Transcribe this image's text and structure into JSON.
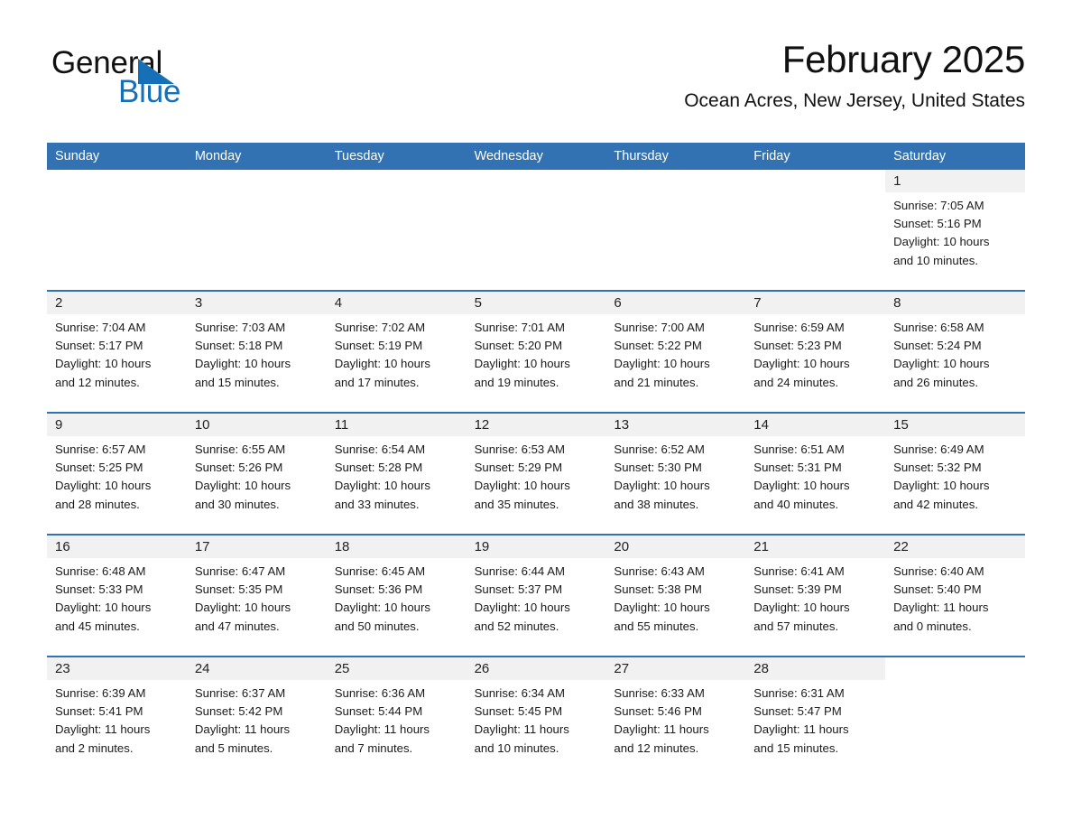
{
  "logo": {
    "word_black": "General",
    "word_blue": "Blue",
    "triangle_color": "#1570b8"
  },
  "header": {
    "title": "February 2025",
    "location": "Ocean Acres, New Jersey, United States"
  },
  "colors": {
    "header_blue": "#3272b2",
    "daynum_band": "#f1f1f1",
    "text": "#1a1a1a"
  },
  "weekdays": [
    "Sunday",
    "Monday",
    "Tuesday",
    "Wednesday",
    "Thursday",
    "Friday",
    "Saturday"
  ],
  "weeks": [
    [
      {
        "day": "",
        "empty": true
      },
      {
        "day": "",
        "empty": true
      },
      {
        "day": "",
        "empty": true
      },
      {
        "day": "",
        "empty": true
      },
      {
        "day": "",
        "empty": true
      },
      {
        "day": "",
        "empty": true
      },
      {
        "day": "1",
        "sunrise": "Sunrise: 7:05 AM",
        "sunset": "Sunset: 5:16 PM",
        "daylight1": "Daylight: 10 hours",
        "daylight2": "and 10 minutes."
      }
    ],
    [
      {
        "day": "2",
        "sunrise": "Sunrise: 7:04 AM",
        "sunset": "Sunset: 5:17 PM",
        "daylight1": "Daylight: 10 hours",
        "daylight2": "and 12 minutes."
      },
      {
        "day": "3",
        "sunrise": "Sunrise: 7:03 AM",
        "sunset": "Sunset: 5:18 PM",
        "daylight1": "Daylight: 10 hours",
        "daylight2": "and 15 minutes."
      },
      {
        "day": "4",
        "sunrise": "Sunrise: 7:02 AM",
        "sunset": "Sunset: 5:19 PM",
        "daylight1": "Daylight: 10 hours",
        "daylight2": "and 17 minutes."
      },
      {
        "day": "5",
        "sunrise": "Sunrise: 7:01 AM",
        "sunset": "Sunset: 5:20 PM",
        "daylight1": "Daylight: 10 hours",
        "daylight2": "and 19 minutes."
      },
      {
        "day": "6",
        "sunrise": "Sunrise: 7:00 AM",
        "sunset": "Sunset: 5:22 PM",
        "daylight1": "Daylight: 10 hours",
        "daylight2": "and 21 minutes."
      },
      {
        "day": "7",
        "sunrise": "Sunrise: 6:59 AM",
        "sunset": "Sunset: 5:23 PM",
        "daylight1": "Daylight: 10 hours",
        "daylight2": "and 24 minutes."
      },
      {
        "day": "8",
        "sunrise": "Sunrise: 6:58 AM",
        "sunset": "Sunset: 5:24 PM",
        "daylight1": "Daylight: 10 hours",
        "daylight2": "and 26 minutes."
      }
    ],
    [
      {
        "day": "9",
        "sunrise": "Sunrise: 6:57 AM",
        "sunset": "Sunset: 5:25 PM",
        "daylight1": "Daylight: 10 hours",
        "daylight2": "and 28 minutes."
      },
      {
        "day": "10",
        "sunrise": "Sunrise: 6:55 AM",
        "sunset": "Sunset: 5:26 PM",
        "daylight1": "Daylight: 10 hours",
        "daylight2": "and 30 minutes."
      },
      {
        "day": "11",
        "sunrise": "Sunrise: 6:54 AM",
        "sunset": "Sunset: 5:28 PM",
        "daylight1": "Daylight: 10 hours",
        "daylight2": "and 33 minutes."
      },
      {
        "day": "12",
        "sunrise": "Sunrise: 6:53 AM",
        "sunset": "Sunset: 5:29 PM",
        "daylight1": "Daylight: 10 hours",
        "daylight2": "and 35 minutes."
      },
      {
        "day": "13",
        "sunrise": "Sunrise: 6:52 AM",
        "sunset": "Sunset: 5:30 PM",
        "daylight1": "Daylight: 10 hours",
        "daylight2": "and 38 minutes."
      },
      {
        "day": "14",
        "sunrise": "Sunrise: 6:51 AM",
        "sunset": "Sunset: 5:31 PM",
        "daylight1": "Daylight: 10 hours",
        "daylight2": "and 40 minutes."
      },
      {
        "day": "15",
        "sunrise": "Sunrise: 6:49 AM",
        "sunset": "Sunset: 5:32 PM",
        "daylight1": "Daylight: 10 hours",
        "daylight2": "and 42 minutes."
      }
    ],
    [
      {
        "day": "16",
        "sunrise": "Sunrise: 6:48 AM",
        "sunset": "Sunset: 5:33 PM",
        "daylight1": "Daylight: 10 hours",
        "daylight2": "and 45 minutes."
      },
      {
        "day": "17",
        "sunrise": "Sunrise: 6:47 AM",
        "sunset": "Sunset: 5:35 PM",
        "daylight1": "Daylight: 10 hours",
        "daylight2": "and 47 minutes."
      },
      {
        "day": "18",
        "sunrise": "Sunrise: 6:45 AM",
        "sunset": "Sunset: 5:36 PM",
        "daylight1": "Daylight: 10 hours",
        "daylight2": "and 50 minutes."
      },
      {
        "day": "19",
        "sunrise": "Sunrise: 6:44 AM",
        "sunset": "Sunset: 5:37 PM",
        "daylight1": "Daylight: 10 hours",
        "daylight2": "and 52 minutes."
      },
      {
        "day": "20",
        "sunrise": "Sunrise: 6:43 AM",
        "sunset": "Sunset: 5:38 PM",
        "daylight1": "Daylight: 10 hours",
        "daylight2": "and 55 minutes."
      },
      {
        "day": "21",
        "sunrise": "Sunrise: 6:41 AM",
        "sunset": "Sunset: 5:39 PM",
        "daylight1": "Daylight: 10 hours",
        "daylight2": "and 57 minutes."
      },
      {
        "day": "22",
        "sunrise": "Sunrise: 6:40 AM",
        "sunset": "Sunset: 5:40 PM",
        "daylight1": "Daylight: 11 hours",
        "daylight2": "and 0 minutes."
      }
    ],
    [
      {
        "day": "23",
        "sunrise": "Sunrise: 6:39 AM",
        "sunset": "Sunset: 5:41 PM",
        "daylight1": "Daylight: 11 hours",
        "daylight2": "and 2 minutes."
      },
      {
        "day": "24",
        "sunrise": "Sunrise: 6:37 AM",
        "sunset": "Sunset: 5:42 PM",
        "daylight1": "Daylight: 11 hours",
        "daylight2": "and 5 minutes."
      },
      {
        "day": "25",
        "sunrise": "Sunrise: 6:36 AM",
        "sunset": "Sunset: 5:44 PM",
        "daylight1": "Daylight: 11 hours",
        "daylight2": "and 7 minutes."
      },
      {
        "day": "26",
        "sunrise": "Sunrise: 6:34 AM",
        "sunset": "Sunset: 5:45 PM",
        "daylight1": "Daylight: 11 hours",
        "daylight2": "and 10 minutes."
      },
      {
        "day": "27",
        "sunrise": "Sunrise: 6:33 AM",
        "sunset": "Sunset: 5:46 PM",
        "daylight1": "Daylight: 11 hours",
        "daylight2": "and 12 minutes."
      },
      {
        "day": "28",
        "sunrise": "Sunrise: 6:31 AM",
        "sunset": "Sunset: 5:47 PM",
        "daylight1": "Daylight: 11 hours",
        "daylight2": "and 15 minutes."
      },
      {
        "day": "",
        "empty": true
      }
    ]
  ]
}
